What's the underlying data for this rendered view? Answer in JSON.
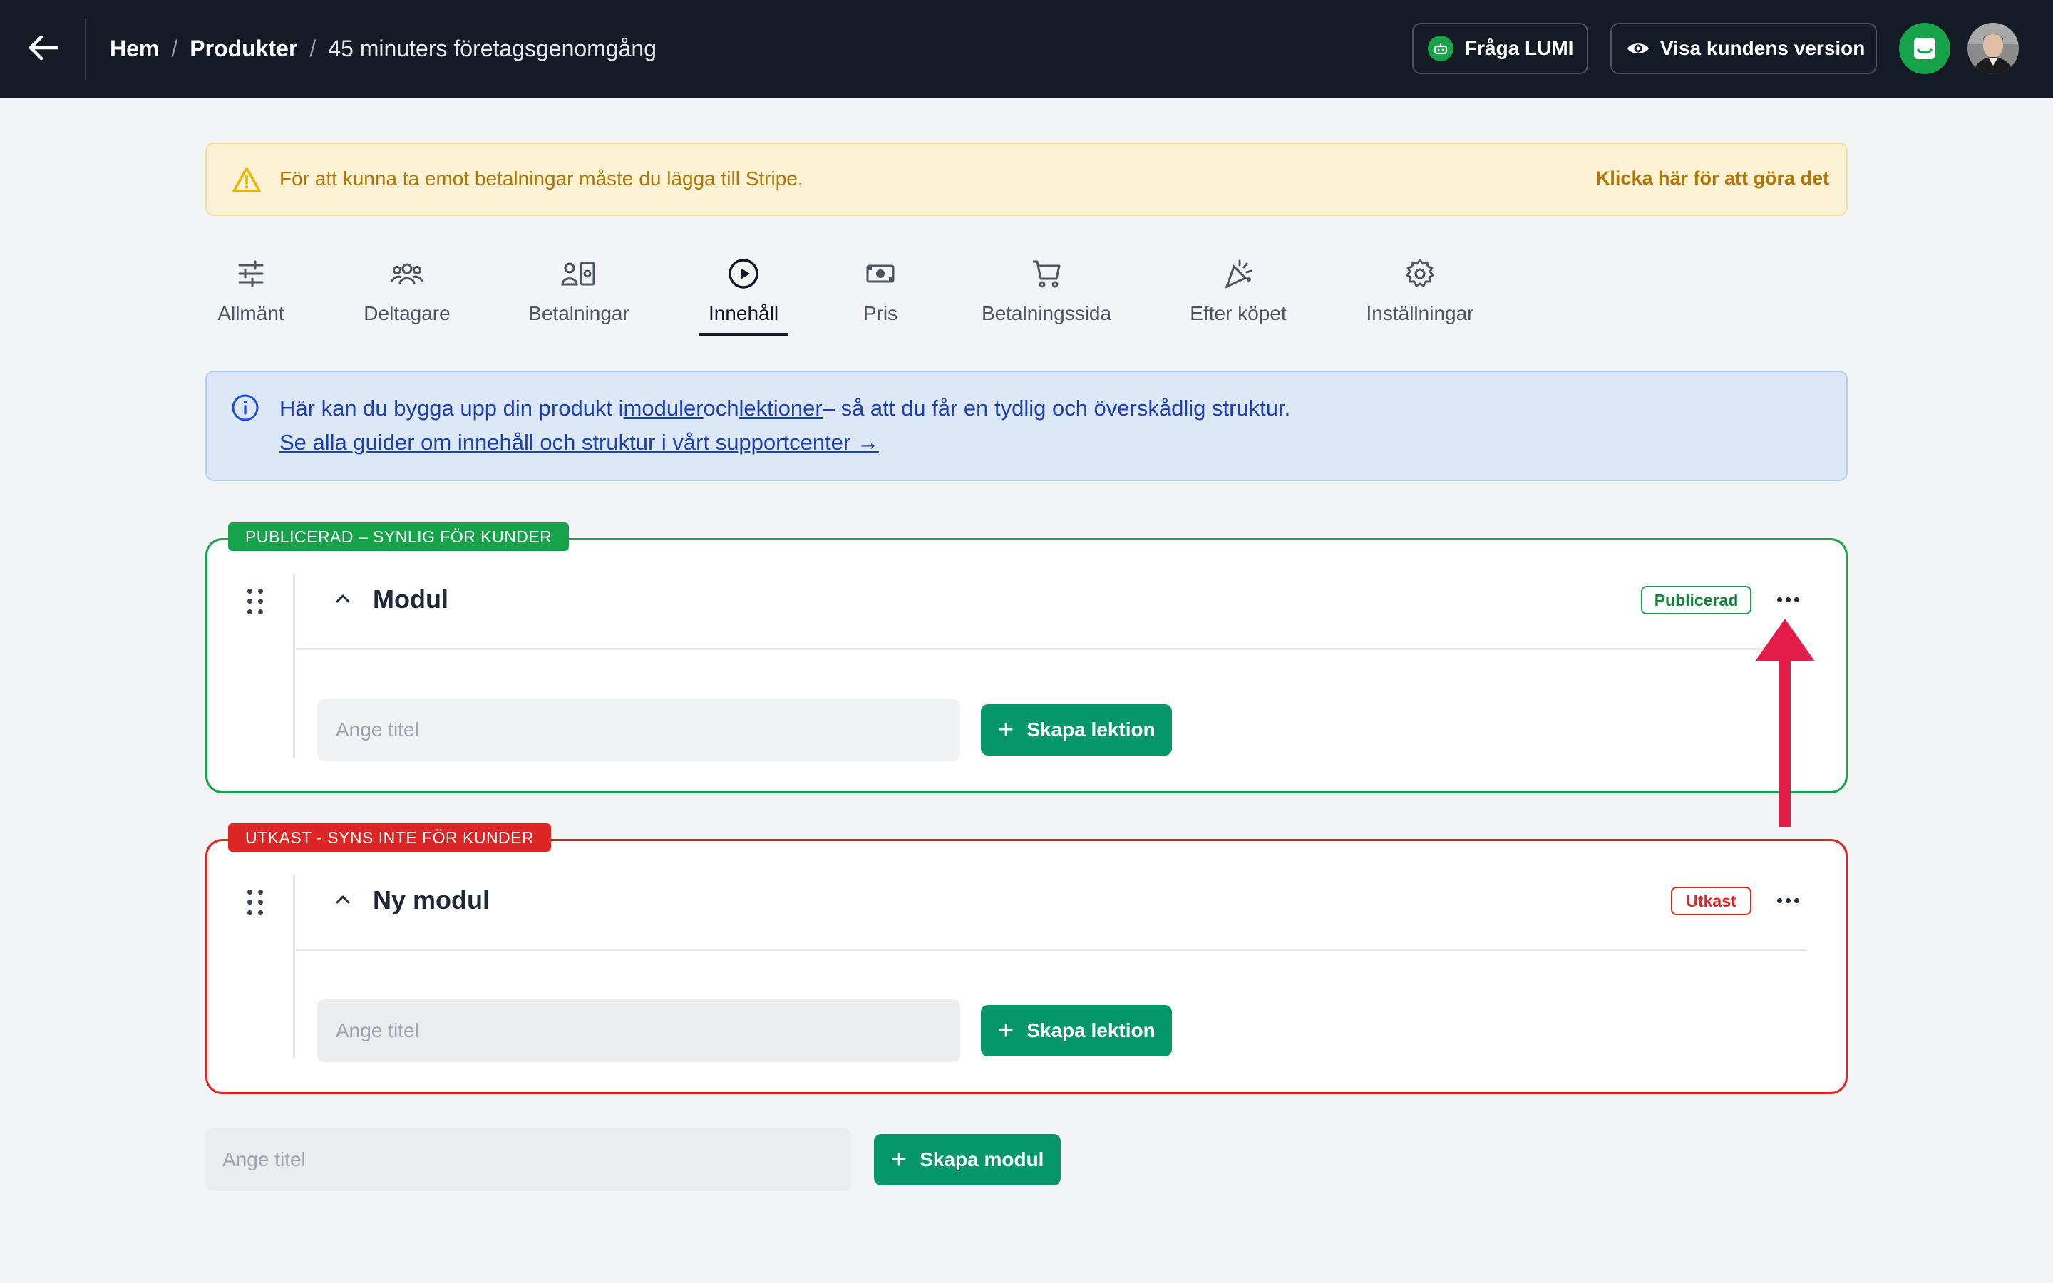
{
  "header": {
    "breadcrumb": [
      "Hem",
      "Produkter",
      "45 minuters företagsgenomgång"
    ],
    "separator": "/",
    "ask_lumi_label": "Fråga LUMI",
    "customer_view_label": "Visa kundens version"
  },
  "banner": {
    "text": "För att kunna ta emot betalningar måste du lägga till Stripe.",
    "link": "Klicka här för att göra det"
  },
  "tabs": [
    {
      "label": "Allmänt",
      "icon": "sliders-icon"
    },
    {
      "label": "Deltagare",
      "icon": "users-icon"
    },
    {
      "label": "Betalningar",
      "icon": "payments-icon"
    },
    {
      "label": "Innehåll",
      "icon": "play-circle-icon",
      "active": true
    },
    {
      "label": "Pris",
      "icon": "banknote-icon"
    },
    {
      "label": "Betalningssida",
      "icon": "cart-icon"
    },
    {
      "label": "Efter köpet",
      "icon": "party-icon"
    },
    {
      "label": "Inställningar",
      "icon": "gear-icon"
    }
  ],
  "info": {
    "line1_start": "Här kan du bygga upp din produkt i",
    "link_modules": "moduler",
    "word_and": "och",
    "link_lessons": "lektioner",
    "line1_end": "– så att du får en tydlig och överskådlig struktur.",
    "line2": "Se alla guider om innehåll och struktur i vårt supportcenter →"
  },
  "modules": [
    {
      "tag": "PUBLICERAD – SYNLIG FÖR KUNDER",
      "title": "Modul",
      "status": "Publicerad",
      "status_color": "#16a34a",
      "input_placeholder": "Ange titel",
      "input_value": "",
      "create_lesson_label": "Skapa lektion"
    },
    {
      "tag": "UTKAST - SYNS INTE FÖR KUNDER",
      "title": "Ny modul",
      "status": "Utkast",
      "status_color": "#dc2626",
      "input_placeholder": "Ange titel",
      "input_value": "",
      "create_lesson_label": "Skapa lektion"
    }
  ],
  "new_module": {
    "input_placeholder": "Ange titel",
    "create_module_label": "Skapa modul"
  },
  "colors": {
    "topbar": "#141a26",
    "primary_green": "#059669",
    "published": "#16a34a",
    "draft": "#dc2626",
    "annotation_arrow": "#e11d48"
  }
}
